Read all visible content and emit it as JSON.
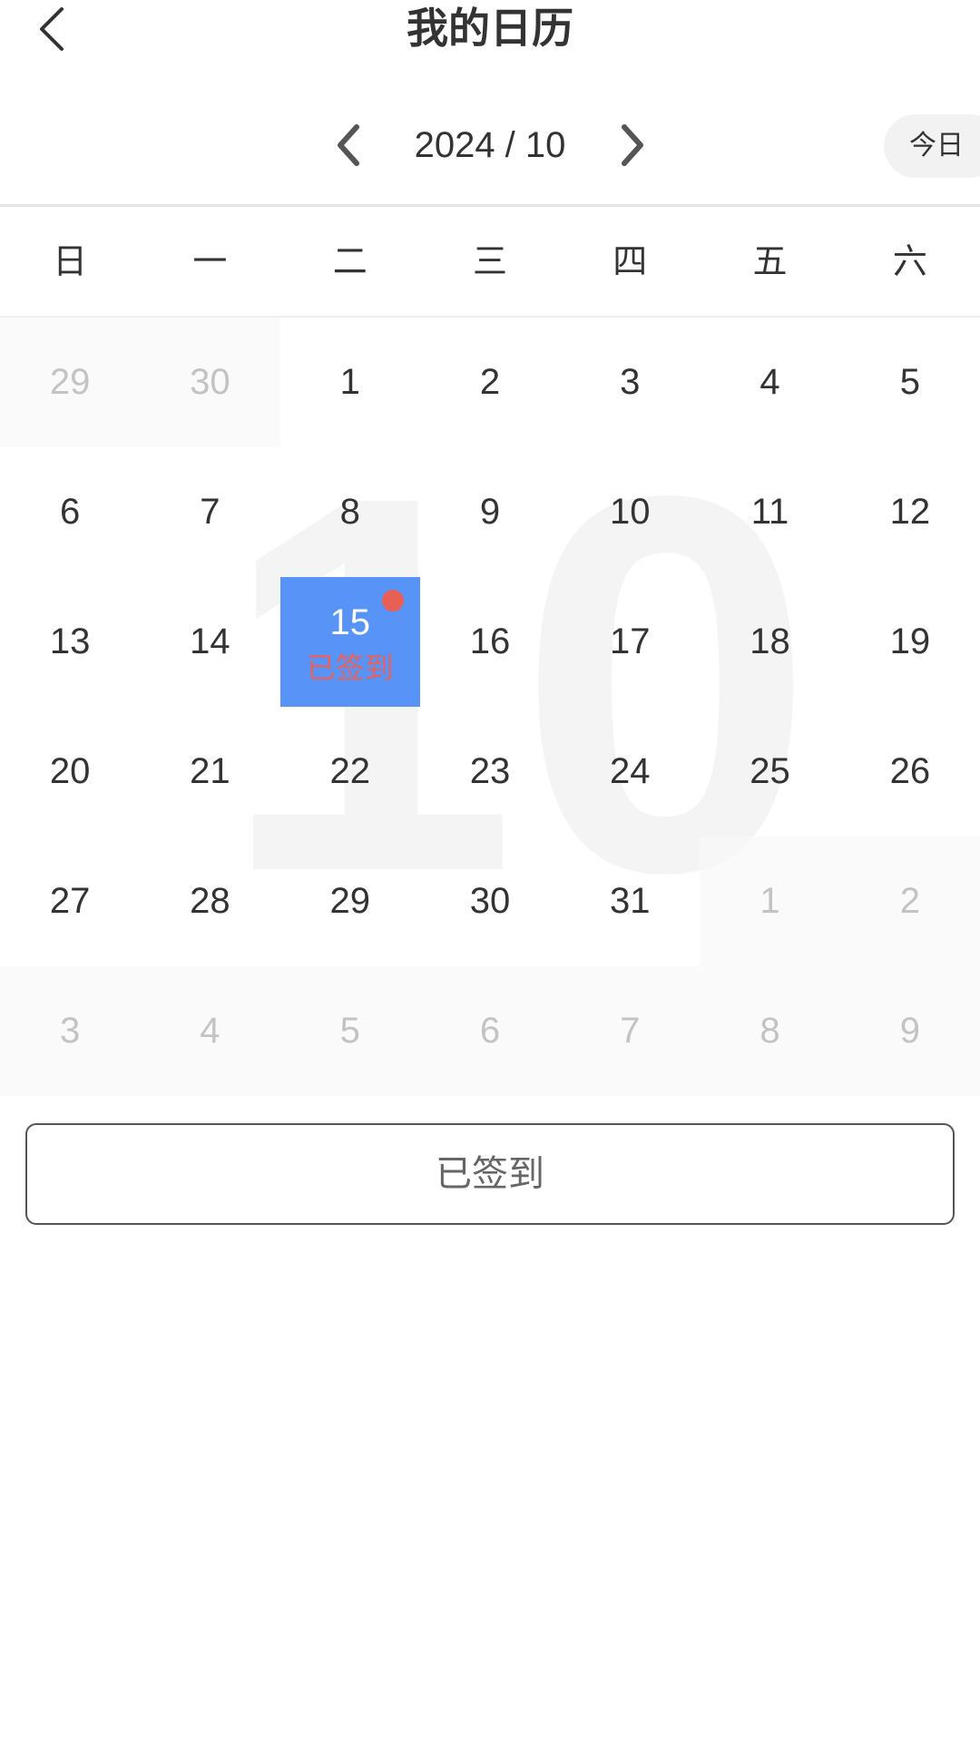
{
  "header": {
    "title": "我的日历",
    "back_icon": "chevron-left-icon"
  },
  "month_nav": {
    "label": "2024 / 10",
    "prev_icon": "chevron-left-icon",
    "next_icon": "chevron-right-icon",
    "today_label": "今日"
  },
  "calendar": {
    "year": 2024,
    "month": 10,
    "watermark": "10",
    "weekdays": [
      "日",
      "一",
      "二",
      "三",
      "四",
      "五",
      "六"
    ],
    "days": [
      {
        "day": "29",
        "in_month": false
      },
      {
        "day": "30",
        "in_month": false
      },
      {
        "day": "1",
        "in_month": true
      },
      {
        "day": "2",
        "in_month": true
      },
      {
        "day": "3",
        "in_month": true
      },
      {
        "day": "4",
        "in_month": true
      },
      {
        "day": "5",
        "in_month": true
      },
      {
        "day": "6",
        "in_month": true
      },
      {
        "day": "7",
        "in_month": true
      },
      {
        "day": "8",
        "in_month": true
      },
      {
        "day": "9",
        "in_month": true
      },
      {
        "day": "10",
        "in_month": true
      },
      {
        "day": "11",
        "in_month": true
      },
      {
        "day": "12",
        "in_month": true
      },
      {
        "day": "13",
        "in_month": true
      },
      {
        "day": "14",
        "in_month": true
      },
      {
        "day": "15",
        "in_month": true,
        "selected": true,
        "mark": "已签到",
        "has_dot": true
      },
      {
        "day": "16",
        "in_month": true
      },
      {
        "day": "17",
        "in_month": true
      },
      {
        "day": "18",
        "in_month": true
      },
      {
        "day": "19",
        "in_month": true
      },
      {
        "day": "20",
        "in_month": true
      },
      {
        "day": "21",
        "in_month": true
      },
      {
        "day": "22",
        "in_month": true
      },
      {
        "day": "23",
        "in_month": true
      },
      {
        "day": "24",
        "in_month": true
      },
      {
        "day": "25",
        "in_month": true
      },
      {
        "day": "26",
        "in_month": true
      },
      {
        "day": "27",
        "in_month": true
      },
      {
        "day": "28",
        "in_month": true
      },
      {
        "day": "29",
        "in_month": true
      },
      {
        "day": "30",
        "in_month": true
      },
      {
        "day": "31",
        "in_month": true
      },
      {
        "day": "1",
        "in_month": false
      },
      {
        "day": "2",
        "in_month": false
      },
      {
        "day": "3",
        "in_month": false
      },
      {
        "day": "4",
        "in_month": false
      },
      {
        "day": "5",
        "in_month": false
      },
      {
        "day": "6",
        "in_month": false
      },
      {
        "day": "7",
        "in_month": false
      },
      {
        "day": "8",
        "in_month": false
      },
      {
        "day": "9",
        "in_month": false
      }
    ]
  },
  "signin_button": {
    "label": "已签到"
  },
  "colors": {
    "selected_bg": "#5894f7",
    "selected_mark": "#e6625c",
    "dot": "#ea5f55",
    "other_month_text": "#c3c3c3",
    "watermark": "#f4f4f4"
  }
}
